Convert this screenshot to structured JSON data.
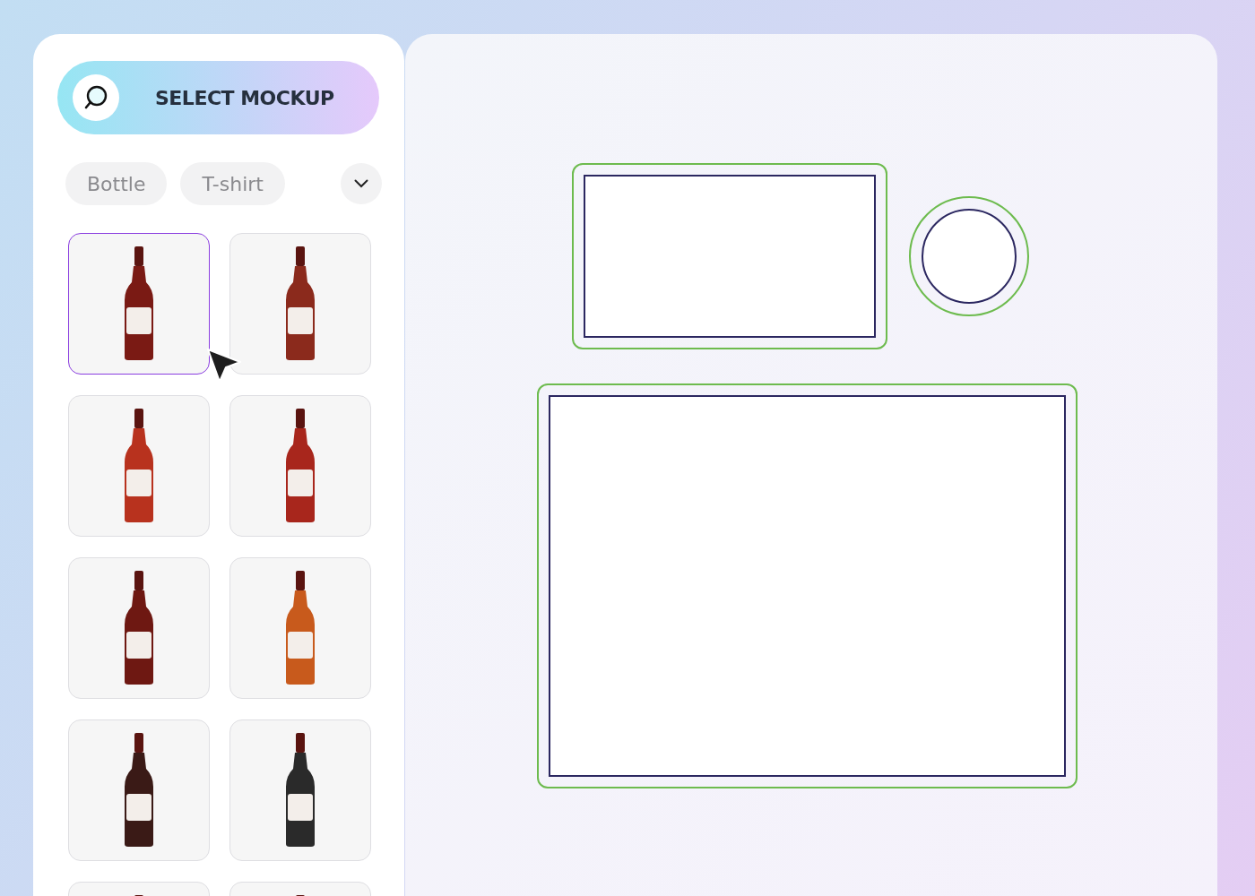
{
  "search": {
    "label": "SELECT MOCKUP"
  },
  "chips": [
    {
      "label": "Bottle",
      "selected": false
    },
    {
      "label": "T-shirt",
      "selected": false
    }
  ],
  "mockups": [
    {
      "selected": true
    },
    {
      "selected": false
    },
    {
      "selected": false
    },
    {
      "selected": false
    },
    {
      "selected": false
    },
    {
      "selected": false
    },
    {
      "selected": false
    },
    {
      "selected": false
    },
    {
      "selected": false
    },
    {
      "selected": false
    }
  ],
  "canvas": {
    "shapes": [
      {
        "kind": "rectangle"
      },
      {
        "kind": "circle"
      },
      {
        "kind": "rectangle"
      }
    ]
  }
}
